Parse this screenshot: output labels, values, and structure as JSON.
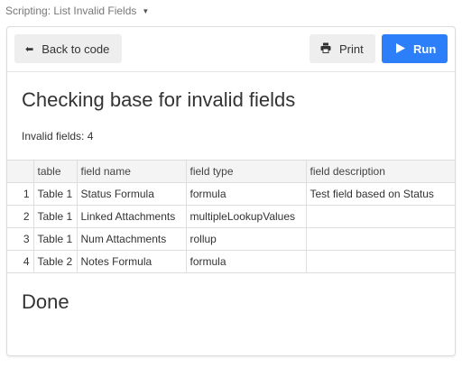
{
  "header": {
    "title": "Scripting: List Invalid Fields",
    "caret": "▼"
  },
  "toolbar": {
    "back_label": "Back to code",
    "back_icon": "⬅",
    "print_label": "Print",
    "print_icon": "🖶",
    "run_label": "Run",
    "run_icon": "▶"
  },
  "output": {
    "heading": "Checking base for invalid fields",
    "count_text": "Invalid fields: 4",
    "done_text": "Done"
  },
  "table": {
    "columns": [
      "",
      "table",
      "field name",
      "field type",
      "field description"
    ],
    "rows": [
      [
        "1",
        "Table 1",
        "Status Formula",
        "formula",
        "Test field based on Status"
      ],
      [
        "2",
        "Table 1",
        "Linked Attachments",
        "multipleLookupValues",
        ""
      ],
      [
        "3",
        "Table 1",
        "Num Attachments",
        "rollup",
        ""
      ],
      [
        "4",
        "Table 2",
        "Notes Formula",
        "formula",
        ""
      ]
    ]
  }
}
